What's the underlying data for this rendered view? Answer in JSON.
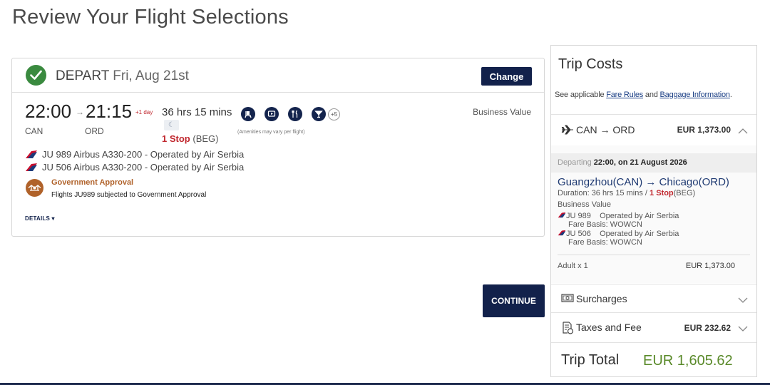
{
  "page": {
    "title": "Review Your Flight Selections"
  },
  "flight": {
    "depart_label": "DEPART",
    "depart_date": "Fri, Aug 21st",
    "change_label": "Change",
    "dep_time": "22:00",
    "arr_time": "21:15",
    "plus_day": "+1 day",
    "dep_code": "CAN",
    "arr_code": "ORD",
    "duration": "36 hrs 15 mins",
    "stops_count": "1 Stop",
    "stops_via": "(BEG)",
    "amenity_more": "+5",
    "amenity_note": "(Amenities may vary per flight)",
    "cabin": "Business Value",
    "segments": [
      {
        "text": "JU 989 Airbus A330-200 - Operated by Air Serbia"
      },
      {
        "text": "JU 506 Airbus A330-200 - Operated by Air Serbia"
      }
    ],
    "gov_title": "Government Approval",
    "gov_text": "Flights JU989 subjected to Government Approval",
    "details_label": "DETAILS ▾"
  },
  "continue_label": "CONTINUE",
  "costs": {
    "title": "Trip Costs",
    "note_pre": "See applicable ",
    "fare_rules": "Fare Rules",
    "note_mid": " and ",
    "baggage": "Baggage Information",
    "note_post": ".",
    "route": "CAN → ORD",
    "route_price": "EUR 1,373.00",
    "departing_label": "Departing",
    "departing_value": "22:00, on 21 August 2026",
    "city_pair": "Guangzhou(CAN) → Chicago(ORD)",
    "duration_prefix": "Duration: 36 hrs 15 mins / ",
    "duration_stop": "1 Stop",
    "duration_via": "(BEG)",
    "fare_class": "Business Value",
    "legs": [
      {
        "flight": "JU 989",
        "operator": "Operated by Air Serbia",
        "fare_basis": "Fare Basis: WOWCN"
      },
      {
        "flight": "JU 506",
        "operator": "Operated by Air Serbia",
        "fare_basis": "Fare Basis: WOWCN"
      }
    ],
    "adult_label": "Adult x 1",
    "adult_price": "EUR 1,373.00",
    "surcharges_label": "Surcharges",
    "taxes_label": "Taxes and Fee",
    "taxes_price": "EUR 232.62",
    "total_label": "Trip Total",
    "total_value": "EUR 1,605.62"
  },
  "icons": {
    "check": "check-icon",
    "amenities": [
      "seat-icon",
      "entertainment-icon",
      "dining-icon",
      "cocktail-icon"
    ],
    "gov": "government-approval-icon",
    "plane": "plane-icon",
    "surcharges": "money-icon",
    "taxes": "receipt-icon"
  },
  "colors": {
    "navy": "#12214b",
    "stop_red": "#c0262d",
    "total_green": "#5a8a2a",
    "gov_brown": "#b0622a"
  }
}
